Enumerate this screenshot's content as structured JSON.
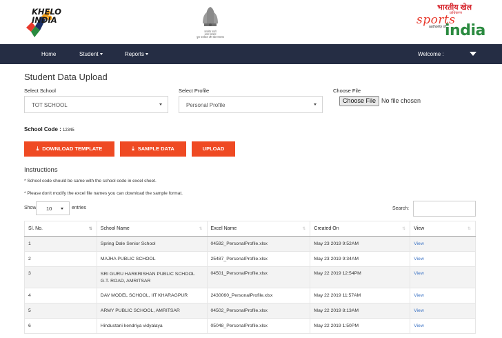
{
  "header": {
    "khelo_line1": "KHELO",
    "khelo_line2": "INDIA",
    "emblem_caption": "सत्यमेव जयते\nभारत सरकार\nयुवा कार्यक्रम और खेल मंत्रालय",
    "sai_hindi": "भारतीय खेल",
    "sai_sub": "प्राधिकरण",
    "sai_sports": "sports",
    "sai_authority": "authority of",
    "sai_india": "india"
  },
  "nav": {
    "home": "Home",
    "student": "Student",
    "reports": "Reports",
    "welcome": "Welcome :"
  },
  "form": {
    "page_title": "Student Data Upload",
    "school_label": "Select School",
    "school_value": "TOT SCHOOL",
    "profile_label": "Select Profile",
    "profile_value": "Personal Profile",
    "file_label": "Choose File",
    "file_button": "Choose File",
    "file_status": "No file chosen",
    "school_code_label": "School Code :",
    "school_code_value": "12345"
  },
  "actions": {
    "download_template": "DOWNLOAD TEMPLATE",
    "sample_data": "SAMPLE DATA",
    "upload": "UPLOAD"
  },
  "instructions": {
    "title": "Instructions",
    "line1": "* School code should be same with the school code in excel sheet.",
    "line2": "* Please don't modify the excel file names you can download the sample format."
  },
  "table_controls": {
    "show": "Show",
    "length": "10",
    "entries": "entries",
    "search_label": "Search:"
  },
  "table": {
    "headers": [
      "Sl. No.",
      "School Name",
      "Excel Name",
      "Created On",
      "View"
    ],
    "rows": [
      [
        "1",
        "Spring Dale Senior School",
        "04592_PersonalProfile.xlsx",
        "May 23 2019 9:52AM",
        "View"
      ],
      [
        "2",
        "MAJHA PUBLIC SCHOOL",
        "25487_PersonalProfile.xlsx",
        "May 23 2019 9:34AM",
        "View"
      ],
      [
        "3",
        "SRI GURU HARKRISHAN PUBLIC SCHOOL G.T. ROAD, AMRITSAR",
        "04501_PersonalProfile.xlsx",
        "May 22 2019 12:54PM",
        "View"
      ],
      [
        "4",
        "DAV MODEL SCHOOL, IIT KHARAGPUR",
        "2430060_PersonalProfile.xlsx",
        "May 22 2019 11:57AM",
        "View"
      ],
      [
        "5",
        "ARMY PUBLIC SCHOOL, AMRITSAR",
        "04502_PersonalProfile.xlsx",
        "May 22 2019 8:13AM",
        "View"
      ],
      [
        "6",
        "Hindustani kendriya vidyalaya",
        "05048_PersonalProfile.xlsx",
        "May 22 2019 1:50PM",
        "View"
      ]
    ]
  },
  "colors": {
    "navbar": "#252d44",
    "accent_orange": "#ef4a23",
    "link_blue": "#3b73c5"
  }
}
